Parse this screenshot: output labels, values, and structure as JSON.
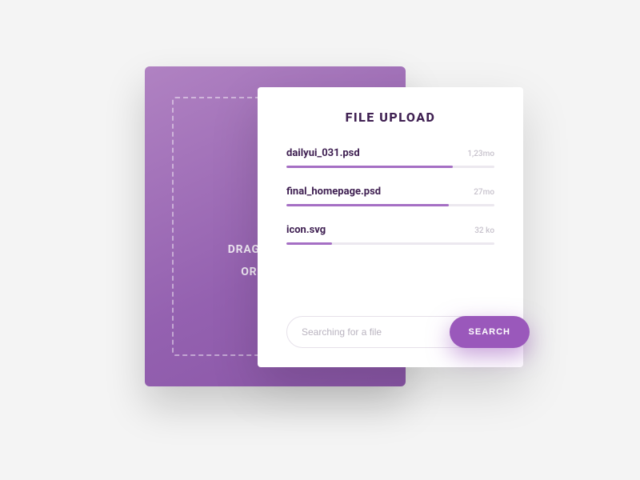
{
  "drop": {
    "line1": "DRAG YOUR FILE",
    "line2": "OR BROWSE"
  },
  "upload": {
    "title": "FILE UPLOAD",
    "files": [
      {
        "name": "dailyui_031.psd",
        "size": "1,23mo",
        "progress": 80
      },
      {
        "name": "final_homepage.psd",
        "size": "27mo",
        "progress": 78
      },
      {
        "name": "icon.svg",
        "size": "32 ko",
        "progress": 22
      }
    ],
    "search_placeholder": "Searching for a file",
    "search_button": "SEARCH"
  }
}
